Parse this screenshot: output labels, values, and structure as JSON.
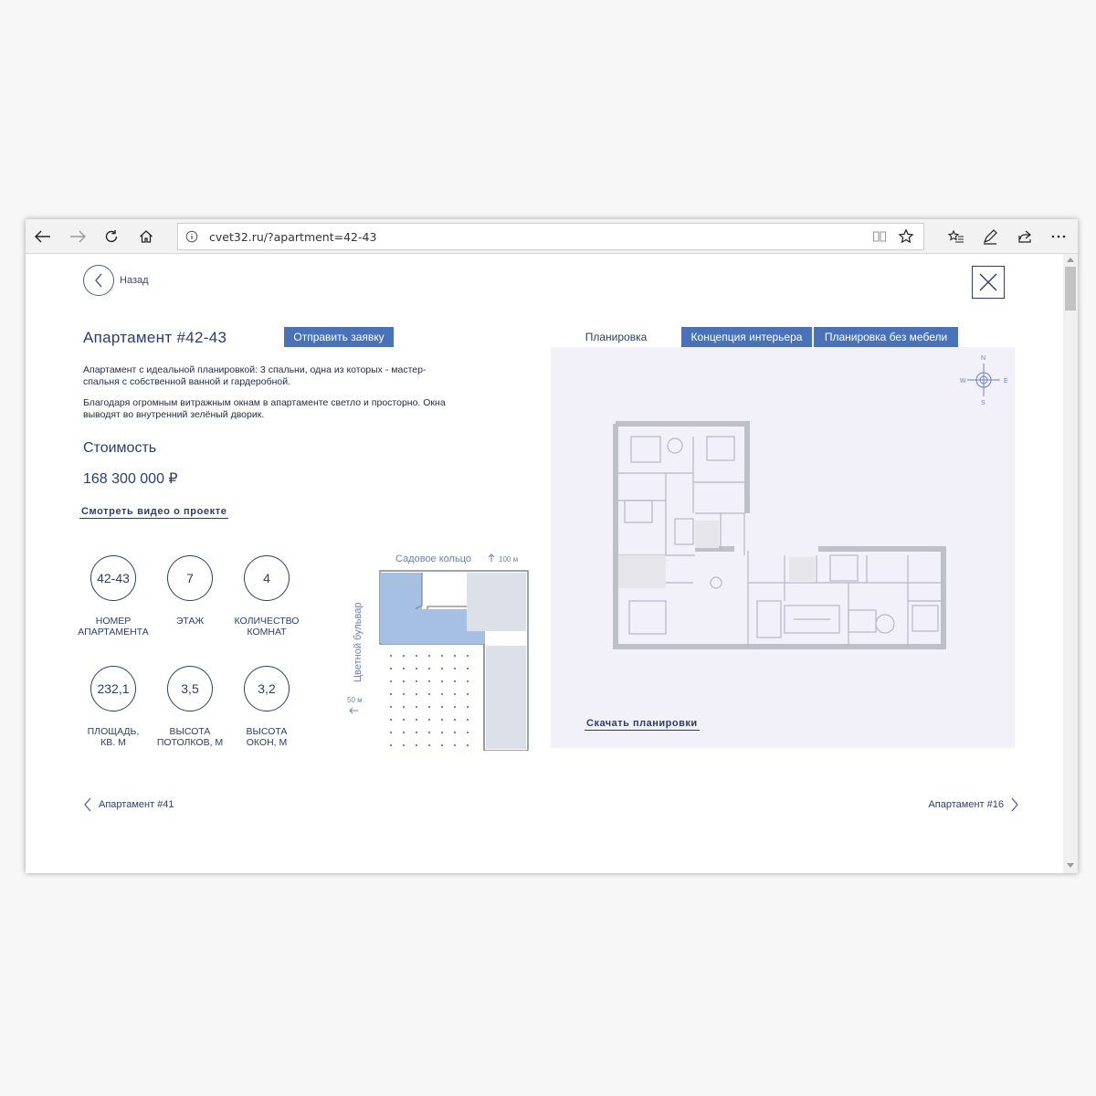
{
  "browser": {
    "url": "cvet32.ru/?apartment=42-43"
  },
  "nav": {
    "back_label": "Назад"
  },
  "apartment": {
    "title": "Апартамент #42-43",
    "request_button": "Отправить заявку",
    "description_1": "Апартамент с идеальной планировкой: 3 спальни, одна из которых - мастер-спальня с собственной ванной и гардеробной.",
    "description_2": "Благодаря огромным витражным окнам в апартаменте светло и просторно. Окна выводят во внутренний зелёный дворик.",
    "cost_label": "Стоимость",
    "price": "168 300 000 ₽",
    "video_link": "Смотреть видео о проекте"
  },
  "stats": [
    {
      "value": "42-43",
      "label_1": "НОМЕР",
      "label_2": "АПАРТАМЕНТА"
    },
    {
      "value": "7",
      "label_1": "ЭТАЖ",
      "label_2": ""
    },
    {
      "value": "4",
      "label_1": "КОЛИЧЕСТВО",
      "label_2": "КОМНАТ"
    },
    {
      "value": "232,1",
      "label_1": "ПЛОЩАДЬ,",
      "label_2": "КВ. М"
    },
    {
      "value": "3,5",
      "label_1": "ВЫСОТА",
      "label_2": "ПОТОЛКОВ, М"
    },
    {
      "value": "3,2",
      "label_1": "ВЫСОТА",
      "label_2": "ОКОН, М"
    }
  ],
  "map": {
    "street_top": "Садовое кольцо",
    "dist_top": "100 м",
    "street_left": "Цветной бульвар",
    "dist_left": "50 м"
  },
  "plan": {
    "tabs": [
      "Планировка",
      "Концепция интерьера",
      "Планировка без мебели"
    ],
    "compass": {
      "n": "N",
      "s": "S",
      "w": "W",
      "e": "E"
    },
    "download_link": "Скачать планировки"
  },
  "pager": {
    "prev": "Апартамент #41",
    "next": "Апартамент #16"
  },
  "colors": {
    "accent": "#4a72b8",
    "text": "#2b3e6b",
    "plan_bg": "#f2f1fa"
  }
}
